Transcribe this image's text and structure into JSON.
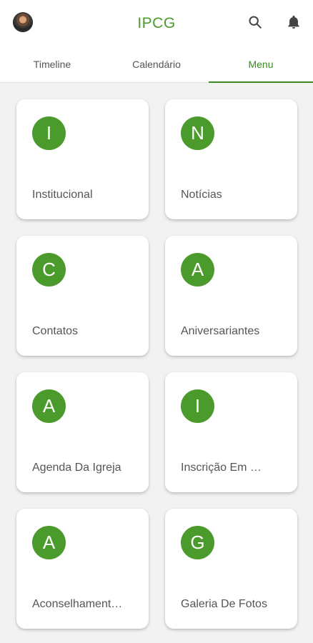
{
  "appbar": {
    "title": "IPCG",
    "avatar_icon": "user-avatar",
    "search_icon": "search-icon",
    "notifications_icon": "bell-icon"
  },
  "tabs": [
    {
      "label": "Timeline",
      "active": false
    },
    {
      "label": "Calendário",
      "active": false
    },
    {
      "label": "Menu",
      "active": true
    }
  ],
  "menu": {
    "items": [
      {
        "initial": "I",
        "label": "Institucional"
      },
      {
        "initial": "N",
        "label": "Notícias"
      },
      {
        "initial": "C",
        "label": "Contatos"
      },
      {
        "initial": "A",
        "label": "Aniversariantes"
      },
      {
        "initial": "A",
        "label": "Agenda Da Igreja"
      },
      {
        "initial": "I",
        "label": "Inscrição Em …"
      },
      {
        "initial": "A",
        "label": "Aconselhament…"
      },
      {
        "initial": "G",
        "label": "Galeria De Fotos"
      }
    ]
  },
  "colors": {
    "accent": "#4a9a2c",
    "background": "#f2f2f2",
    "card": "#ffffff"
  }
}
